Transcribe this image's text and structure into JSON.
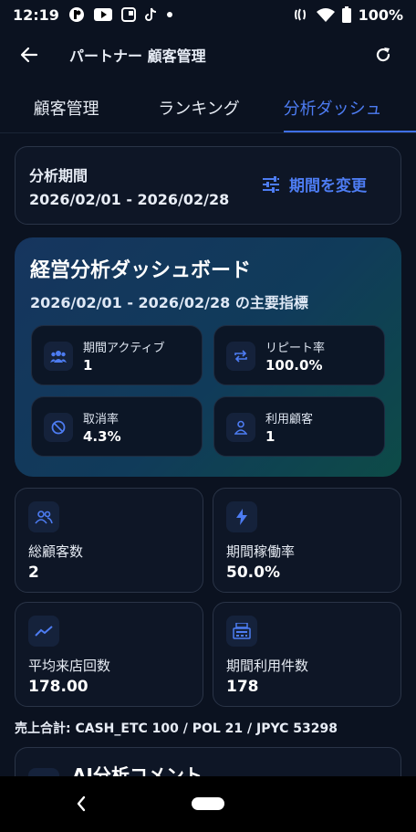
{
  "status_bar": {
    "time": "12:19",
    "battery": "100%"
  },
  "appbar": {
    "title": "パートナー 顧客管理"
  },
  "tabs": [
    {
      "label": "顧客管理",
      "active": false
    },
    {
      "label": "ランキング",
      "active": false
    },
    {
      "label": "分析ダッシュ",
      "active": true
    }
  ],
  "period": {
    "label": "分析期間",
    "range": "2026/02/01 - 2026/02/28",
    "change_button": "期間を変更"
  },
  "hero": {
    "title": "経営分析ダッシュボード",
    "subtitle": "2026/02/01 - 2026/02/28 の主要指標",
    "kpis": [
      {
        "label": "期間アクティブ",
        "value": "1",
        "icon": "people-icon"
      },
      {
        "label": "リピート率",
        "value": "100.0%",
        "icon": "repeat-icon"
      },
      {
        "label": "取消率",
        "value": "4.3%",
        "icon": "cancel-icon"
      },
      {
        "label": "利用顧客",
        "value": "1",
        "icon": "person-icon"
      }
    ]
  },
  "stats": [
    {
      "label": "総顧客数",
      "value": "2",
      "icon": "group-icon"
    },
    {
      "label": "期間稼働率",
      "value": "50.0%",
      "icon": "bolt-icon"
    },
    {
      "label": "平均来店回数",
      "value": "178.00",
      "icon": "trend-icon"
    },
    {
      "label": "期間利用件数",
      "value": "178",
      "icon": "register-icon"
    }
  ],
  "sales_total": "売上合計: CASH_ETC 100 / POL 21 / JPYC 53298",
  "ai_comment": {
    "title": "AI分析コメント"
  },
  "colors": {
    "accent": "#4d7cf2",
    "background": "#0b1220",
    "card_border": "#2a3447"
  }
}
